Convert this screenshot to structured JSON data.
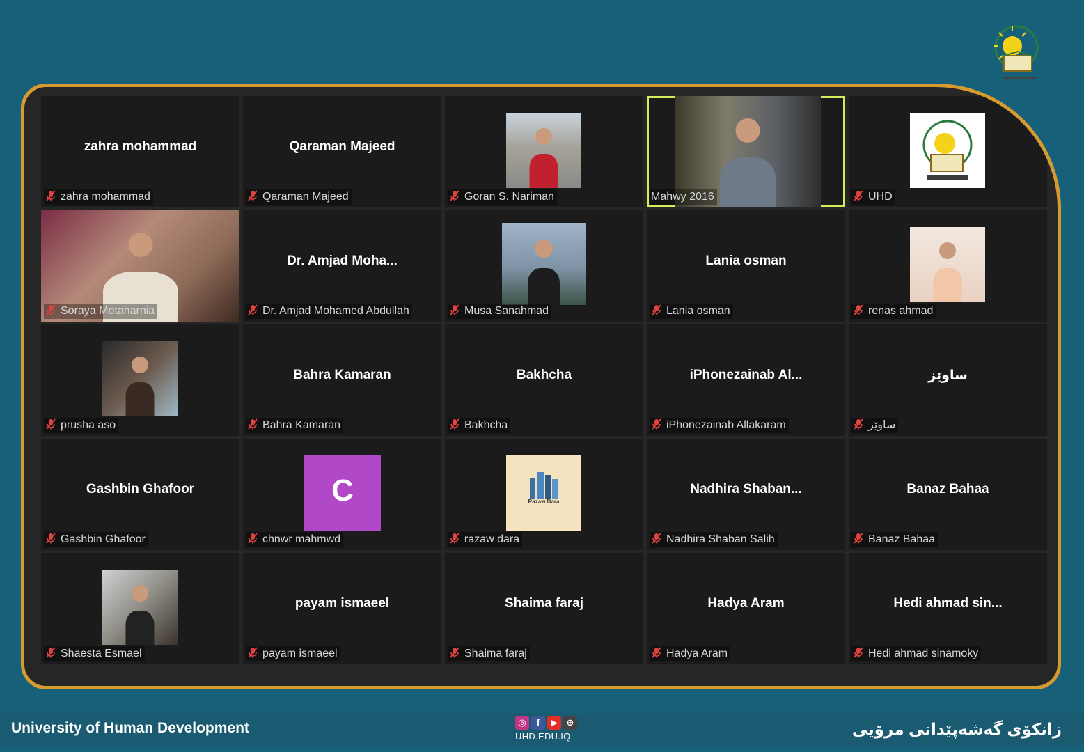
{
  "colors": {
    "background": "#17607a",
    "frame_border": "#d69a2e",
    "tile_bg": "#1b1b1b",
    "active_speaker_border": "#d7ec5a",
    "muted_mic": "#e0433f"
  },
  "logo": {
    "icon": "university-logo-icon"
  },
  "participants": [
    {
      "display": "zahra mohammad",
      "label": "zahra mohammad",
      "video": false
    },
    {
      "display": "Qaraman Majeed",
      "label": "Qaraman Majeed",
      "video": false
    },
    {
      "display": "",
      "label": "Goran S. Nariman",
      "video": true
    },
    {
      "display": "",
      "label": "Mahwy 2016",
      "video": true,
      "active": true
    },
    {
      "display": "",
      "label": "UHD",
      "video": true
    },
    {
      "display": "",
      "label": "Soraya Motaharnia",
      "video": true
    },
    {
      "display": "Dr. Amjad Moha...",
      "label": "Dr. Amjad Mohamed Abdullah",
      "video": false
    },
    {
      "display": "",
      "label": "Musa Sanahmad",
      "video": true
    },
    {
      "display": "Lania osman",
      "label": "Lania osman",
      "video": false
    },
    {
      "display": "",
      "label": "renas ahmad",
      "video": true
    },
    {
      "display": "",
      "label": "prusha aso",
      "video": true
    },
    {
      "display": "Bahra Kamaran",
      "label": "Bahra Kamaran",
      "video": false
    },
    {
      "display": "Bakhcha",
      "label": "Bakhcha",
      "video": false
    },
    {
      "display": "iPhonezainab Al...",
      "label": "iPhonezainab Allakaram",
      "video": false
    },
    {
      "display": "ساوێز",
      "label": "ساوێز",
      "video": false
    },
    {
      "display": "Gashbin Ghafoor",
      "label": "Gashbin Ghafoor",
      "video": false
    },
    {
      "display": "",
      "label": "chnwr mahmwd",
      "video": true,
      "avatar_letter": "C"
    },
    {
      "display": "",
      "label": "razaw dara",
      "video": true,
      "avatar_caption": "Razaw Dara"
    },
    {
      "display": "Nadhira Shaban...",
      "label": "Nadhira Shaban Salih",
      "video": false
    },
    {
      "display": "Banaz Bahaa",
      "label": "Banaz Bahaa",
      "video": false
    },
    {
      "display": "",
      "label": "Shaesta Esmael",
      "video": true
    },
    {
      "display": "payam ismaeel",
      "label": "payam ismaeel",
      "video": false
    },
    {
      "display": "Shaima faraj",
      "label": "Shaima faraj",
      "video": false
    },
    {
      "display": "Hadya Aram",
      "label": "Hadya Aram",
      "video": false
    },
    {
      "display": "Hedi ahmad sin...",
      "label": "Hedi ahmad sinamoky",
      "video": false
    }
  ],
  "footer": {
    "english_name": "University of Human Development",
    "kurdish_name": "زانكۆی گەشەپێدانی مرۆیی",
    "website": "UHD.EDU.IQ",
    "social_icons": [
      "instagram-icon",
      "facebook-icon",
      "youtube-icon",
      "web-icon"
    ]
  }
}
